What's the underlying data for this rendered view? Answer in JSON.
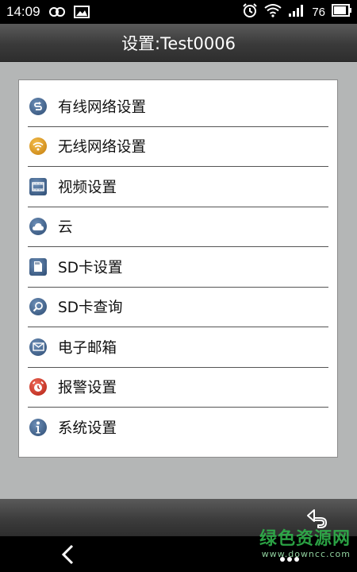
{
  "status_bar": {
    "time": "14:09",
    "battery": "76",
    "icons": [
      "infinity-icon",
      "image-icon",
      "alarm-icon",
      "wifi-icon",
      "signal-icon",
      "battery-icon"
    ]
  },
  "header": {
    "title": "设置:Test0006"
  },
  "menu": {
    "items": [
      {
        "label": "有线网络设置",
        "icon": "wired-network-icon"
      },
      {
        "label": "无线网络设置",
        "icon": "wifi-icon"
      },
      {
        "label": "视频设置",
        "icon": "video-icon"
      },
      {
        "label": "云",
        "icon": "cloud-icon"
      },
      {
        "label": "SD卡设置",
        "icon": "sd-card-icon"
      },
      {
        "label": "SD卡查询",
        "icon": "search-icon"
      },
      {
        "label": "电子邮箱",
        "icon": "email-icon"
      },
      {
        "label": "报警设置",
        "icon": "alarm-clock-icon"
      },
      {
        "label": "系统设置",
        "icon": "info-icon"
      }
    ]
  },
  "toolbar": {
    "back_icon": "return-arrow-icon"
  },
  "navbar": {
    "icons": [
      "nav-back-icon",
      "overflow-menu-icon"
    ]
  },
  "watermark": {
    "title": "绿色资源网",
    "url": "www.downcc.com"
  },
  "colors": {
    "accent_blue": "#2c4b72",
    "wifi_orange": "#c27b0a",
    "alarm_red": "#b01e10",
    "background_grey": "#b4b6b6"
  }
}
